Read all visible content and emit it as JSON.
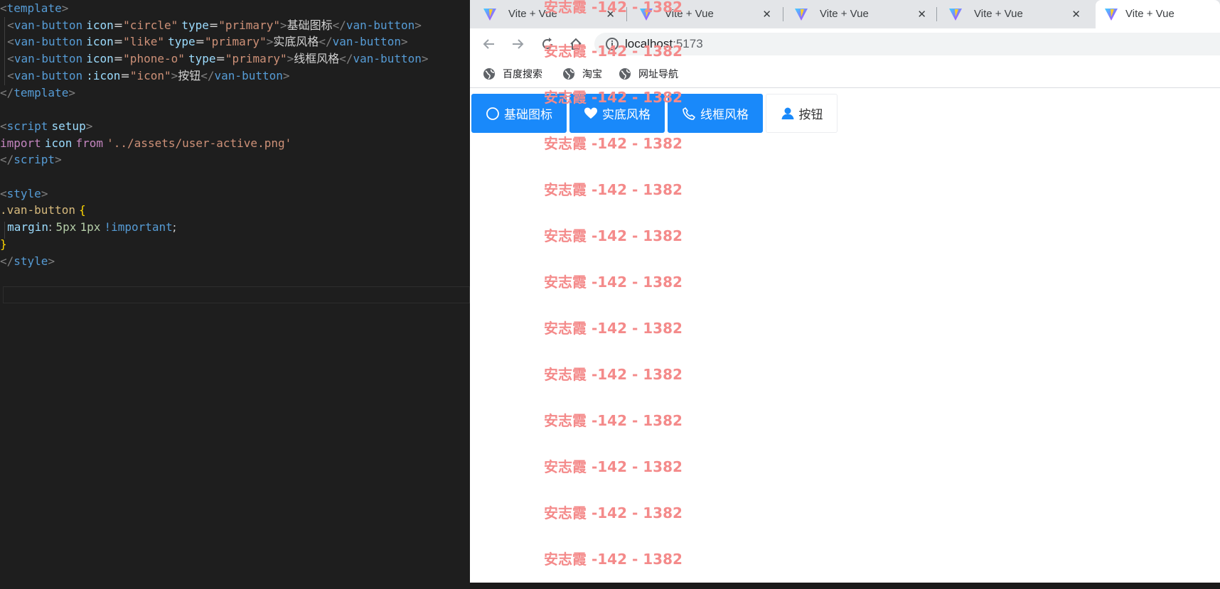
{
  "editor": {
    "lines": [
      {
        "tokens": [
          [
            "tok-punc",
            "<"
          ],
          [
            "tok-tag",
            "template"
          ],
          [
            "tok-punc",
            ">"
          ]
        ]
      },
      {
        "tokens": [
          [
            "tok-text",
            "  "
          ],
          [
            "tok-punc",
            "<"
          ],
          [
            "tok-tag",
            "van-button"
          ],
          [
            "tok-text",
            " "
          ],
          [
            "tok-attr",
            "icon"
          ],
          [
            "tok-text",
            "="
          ],
          [
            "tok-str",
            "\"circle\""
          ],
          [
            "tok-text",
            " "
          ],
          [
            "tok-attr",
            "type"
          ],
          [
            "tok-text",
            "="
          ],
          [
            "tok-str",
            "\"primary\""
          ],
          [
            "tok-punc",
            ">"
          ],
          [
            "tok-text",
            "基础图标"
          ],
          [
            "tok-punc",
            "</"
          ],
          [
            "tok-tag",
            "van-button"
          ],
          [
            "tok-punc",
            ">"
          ]
        ]
      },
      {
        "tokens": [
          [
            "tok-text",
            "  "
          ],
          [
            "tok-punc",
            "<"
          ],
          [
            "tok-tag",
            "van-button"
          ],
          [
            "tok-text",
            " "
          ],
          [
            "tok-attr",
            "icon"
          ],
          [
            "tok-text",
            "="
          ],
          [
            "tok-str",
            "\"like\""
          ],
          [
            "tok-text",
            " "
          ],
          [
            "tok-attr",
            "type"
          ],
          [
            "tok-text",
            "="
          ],
          [
            "tok-str",
            "\"primary\""
          ],
          [
            "tok-punc",
            ">"
          ],
          [
            "tok-text",
            "实底风格"
          ],
          [
            "tok-punc",
            "</"
          ],
          [
            "tok-tag",
            "van-button"
          ],
          [
            "tok-punc",
            ">"
          ]
        ]
      },
      {
        "tokens": [
          [
            "tok-text",
            "  "
          ],
          [
            "tok-punc",
            "<"
          ],
          [
            "tok-tag",
            "van-button"
          ],
          [
            "tok-text",
            " "
          ],
          [
            "tok-attr",
            "icon"
          ],
          [
            "tok-text",
            "="
          ],
          [
            "tok-str",
            "\"phone-o\""
          ],
          [
            "tok-text",
            " "
          ],
          [
            "tok-attr",
            "type"
          ],
          [
            "tok-text",
            "="
          ],
          [
            "tok-str",
            "\"primary\""
          ],
          [
            "tok-punc",
            ">"
          ],
          [
            "tok-text",
            "线框风格"
          ],
          [
            "tok-punc",
            "</"
          ],
          [
            "tok-tag",
            "van-button"
          ],
          [
            "tok-punc",
            ">"
          ]
        ]
      },
      {
        "tokens": [
          [
            "tok-text",
            "  "
          ],
          [
            "tok-punc",
            "<"
          ],
          [
            "tok-tag",
            "van-button"
          ],
          [
            "tok-text",
            " "
          ],
          [
            "tok-attr",
            ":icon"
          ],
          [
            "tok-text",
            "="
          ],
          [
            "tok-str",
            "\"icon\""
          ],
          [
            "tok-punc",
            ">"
          ],
          [
            "tok-text",
            "按钮"
          ],
          [
            "tok-punc",
            "</"
          ],
          [
            "tok-tag",
            "van-button"
          ],
          [
            "tok-punc",
            ">"
          ]
        ]
      },
      {
        "tokens": [
          [
            "tok-punc",
            "</"
          ],
          [
            "tok-tag",
            "template"
          ],
          [
            "tok-punc",
            ">"
          ]
        ]
      },
      {
        "tokens": []
      },
      {
        "tokens": [
          [
            "tok-punc",
            "<"
          ],
          [
            "tok-tag",
            "script"
          ],
          [
            "tok-text",
            " "
          ],
          [
            "tok-attr",
            "setup"
          ],
          [
            "tok-punc",
            ">"
          ]
        ]
      },
      {
        "tokens": [
          [
            "tok-kw",
            "import"
          ],
          [
            "tok-text",
            " "
          ],
          [
            "tok-var",
            "icon"
          ],
          [
            "tok-text",
            " "
          ],
          [
            "tok-kw",
            "from"
          ],
          [
            "tok-text",
            " "
          ],
          [
            "tok-str",
            "'../assets/user-active.png'"
          ]
        ]
      },
      {
        "tokens": [
          [
            "tok-punc",
            "</"
          ],
          [
            "tok-tag",
            "script"
          ],
          [
            "tok-punc",
            ">"
          ]
        ]
      },
      {
        "tokens": []
      },
      {
        "tokens": [
          [
            "tok-punc",
            "<"
          ],
          [
            "tok-tag",
            "style"
          ],
          [
            "tok-punc",
            ">"
          ]
        ]
      },
      {
        "tokens": [
          [
            "tok-sel",
            ".van-button"
          ],
          [
            "tok-text",
            " "
          ],
          [
            "tok-brace",
            "{"
          ]
        ]
      },
      {
        "tokens": [
          [
            "tok-text",
            "  "
          ],
          [
            "tok-prop",
            "margin"
          ],
          [
            "tok-text",
            ": "
          ],
          [
            "tok-num",
            "5px"
          ],
          [
            "tok-text",
            " "
          ],
          [
            "tok-num",
            "1px"
          ],
          [
            "tok-text",
            " "
          ],
          [
            "tok-imp",
            "!important"
          ],
          [
            "tok-text",
            ";"
          ]
        ]
      },
      {
        "tokens": [
          [
            "tok-brace",
            "}"
          ]
        ]
      },
      {
        "tokens": [
          [
            "tok-punc",
            "</"
          ],
          [
            "tok-tag",
            "style"
          ],
          [
            "tok-punc",
            ">"
          ]
        ]
      }
    ]
  },
  "browser": {
    "tabs": [
      {
        "title": "Vite + Vue",
        "close": "✕",
        "active": false
      },
      {
        "title": "Vite + Vue",
        "close": "✕",
        "active": false
      },
      {
        "title": "Vite + Vue",
        "close": "✕",
        "active": false
      },
      {
        "title": "Vite + Vue",
        "close": "✕",
        "active": false
      },
      {
        "title": "Vite + Vue",
        "close": "",
        "active": true
      }
    ],
    "url_host": "localhost",
    "url_port": ":5173",
    "bookmarks": [
      {
        "label": "百度搜索",
        "icon": "globe-icon"
      },
      {
        "label": "淘宝",
        "icon": "globe-icon"
      },
      {
        "label": "网址导航",
        "icon": "globe-icon"
      }
    ]
  },
  "page": {
    "buttons": [
      {
        "label": "基础图标",
        "icon": "circle-icon",
        "type": "primary"
      },
      {
        "label": "实底风格",
        "icon": "heart-icon",
        "type": "primary"
      },
      {
        "label": "线框风格",
        "icon": "phone-icon",
        "type": "primary"
      },
      {
        "label": "按钮",
        "icon": "user-icon",
        "type": "default"
      }
    ],
    "watermark": "安志霞 -142 - 1382",
    "colors": {
      "primary": "#1989fa",
      "watermark": "#f48a8a"
    }
  }
}
